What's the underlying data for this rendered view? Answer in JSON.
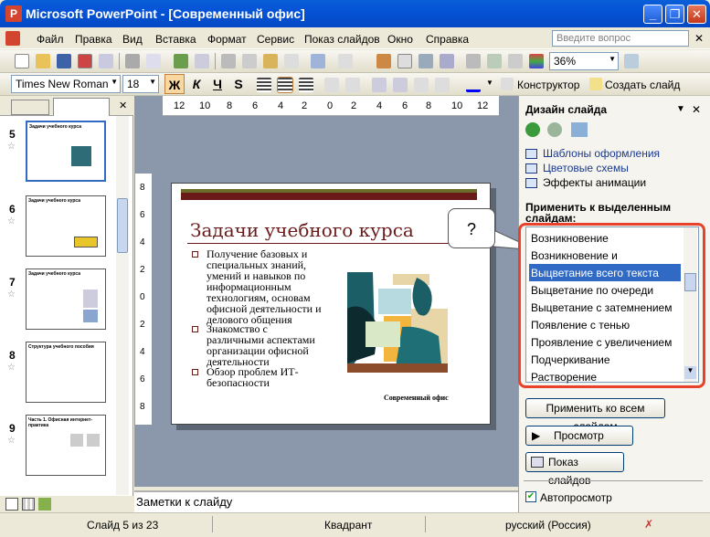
{
  "window": {
    "app_icon": "powerpoint-icon",
    "title": "Microsoft PowerPoint - [Современный офис]",
    "min": "_",
    "restore": "❐",
    "close": "✕"
  },
  "menu": {
    "items": [
      "Файл",
      "Правка",
      "Вид",
      "Вставка",
      "Формат",
      "Сервис",
      "Показ слайдов",
      "Окно",
      "Справка"
    ],
    "help_placeholder": "Введите вопрос",
    "close": "✕"
  },
  "toolbar": {
    "zoom": "36%",
    "font_name": "Times New Roman",
    "font_size": "18",
    "bold": "Ж",
    "italic": "К",
    "underline": "Ч",
    "shadow": "S",
    "designer_label": "Конструктор",
    "new_slide_label": "Создать слайд"
  },
  "ruler": {
    "h_ticks": [
      "12",
      "10",
      "8",
      "6",
      "4",
      "2",
      "0",
      "2",
      "4",
      "6",
      "8",
      "10",
      "12"
    ],
    "v_ticks": [
      "8",
      "6",
      "4",
      "2",
      "0",
      "2",
      "4",
      "6",
      "8"
    ]
  },
  "thumbnails": [
    {
      "num": "5",
      "title": "Задачи учебного курса"
    },
    {
      "num": "6",
      "title": "Задачи учебного курса"
    },
    {
      "num": "7",
      "title": "Задачи учебного курса"
    },
    {
      "num": "8",
      "title": "Структура учебного пособия"
    },
    {
      "num": "9",
      "title": "Часть 1. Офисная интернет-практика"
    }
  ],
  "slide": {
    "title": "Задачи учебного курса",
    "bullets": [
      "Получение базовых и специальных знаний, умений и навыков по информационным технологиям, основам офисной деятельности и делового общения",
      "Знакомство с различными аспектами организации офисной деятельности",
      "Обзор проблем ИТ-безопасности"
    ],
    "footer": "Современный офис"
  },
  "notes": {
    "placeholder": "Заметки к слайду"
  },
  "taskpane": {
    "title": "Дизайн слайда",
    "links": [
      "Шаблоны оформления",
      "Цветовые схемы",
      "Эффекты анимации"
    ],
    "apply_label": "Применить к выделенным слайдам:",
    "effects": [
      "Возникновение",
      "Возникновение и затемнение",
      "Выцветание всего текста",
      "Выцветание по очереди",
      "Выцветание с затемнением",
      "Появление с тенью",
      "Проявление с увеличением",
      "Подчеркивание",
      "Растворение"
    ],
    "selected_effect": "Выцветание всего текста",
    "apply_all_button": "Применить ко всем слайдам",
    "preview_button": "Просмотр",
    "slideshow_button": "Показ слайдов",
    "autopreview_label": "Автопросмотр",
    "autopreview_checked": true
  },
  "callout": {
    "text": "?"
  },
  "status": {
    "slide_info": "Слайд 5 из 23",
    "design": "Квадрант",
    "language": "русский (Россия)"
  },
  "colors": {
    "title_bar": "#0553d6",
    "slide_accent": "#6b1a1a",
    "selection": "#316ac5",
    "highlight": "#e8412c"
  }
}
